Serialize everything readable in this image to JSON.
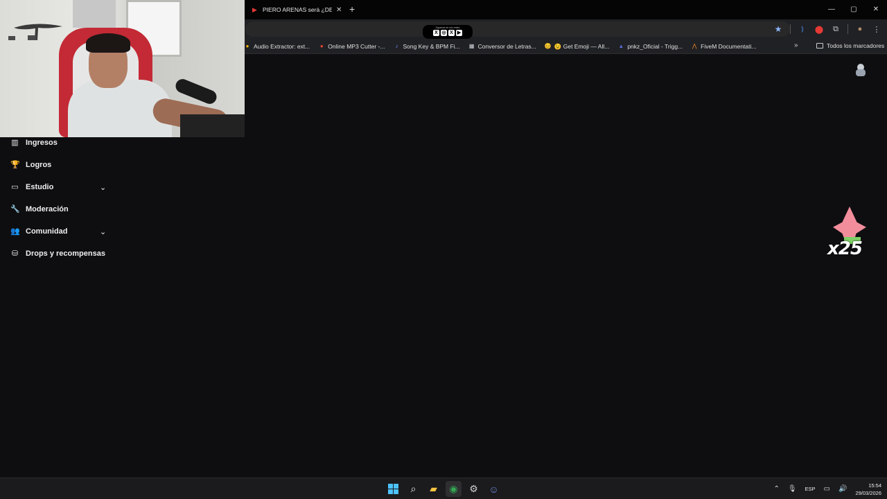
{
  "browser": {
    "tab_title": "PIERO ARENAS será ¿DENU",
    "tab_close": "✕",
    "new_tab": "+",
    "window_controls": [
      "—",
      "▢",
      "✕"
    ]
  },
  "badge": {
    "caption": "Sígueme en mis redes",
    "icons": [
      "X",
      "◎",
      "X",
      "▶"
    ]
  },
  "bookmarks": {
    "items": [
      {
        "label": "Audio Extractor: ext...",
        "icon": "●",
        "color": "#f4b400"
      },
      {
        "label": "Online MP3 Cutter -...",
        "icon": "●",
        "color": "#ea4335"
      },
      {
        "label": "Song Key & BPM Fi...",
        "icon": "♪",
        "color": "#7b8cff"
      },
      {
        "label": "Conversor de Letras...",
        "icon": "▦",
        "color": "#cfd3da"
      },
      {
        "label": "😉 Get Emoji — All...",
        "icon": "😊",
        "color": "#f4c542"
      },
      {
        "label": "pnkz_Oficial - Trigg...",
        "icon": "▲",
        "color": "#5b6bd6"
      },
      {
        "label": "FiveM Documentati...",
        "icon": "⋀",
        "color": "#f28c28"
      }
    ],
    "more": "»",
    "all_label": "Todos los marcadores"
  },
  "sidebar": {
    "items": [
      {
        "label": "Ingresos",
        "icon": "▥",
        "has_chevron": false
      },
      {
        "label": "Logros",
        "icon": "🏆",
        "has_chevron": false
      },
      {
        "label": "Estudio",
        "icon": "▭",
        "has_chevron": true
      },
      {
        "label": "Moderación",
        "icon": "🔧",
        "has_chevron": false
      },
      {
        "label": "Comunidad",
        "icon": "👥",
        "has_chevron": true
      },
      {
        "label": "Drops y recompensas",
        "icon": "⛁",
        "has_chevron": false
      }
    ],
    "chevron": "⌄"
  },
  "overlay": {
    "multiplier": "x25"
  },
  "taskbar": {
    "apps": [
      "windows-start",
      "search",
      "file-explorer",
      "chrome",
      "steam",
      "discord"
    ],
    "tray": {
      "language": "ESP",
      "time": "15:54",
      "date": "29/03/2026"
    }
  },
  "colors": {
    "background": "#0e0e10",
    "accent": "#4cc2ff"
  }
}
